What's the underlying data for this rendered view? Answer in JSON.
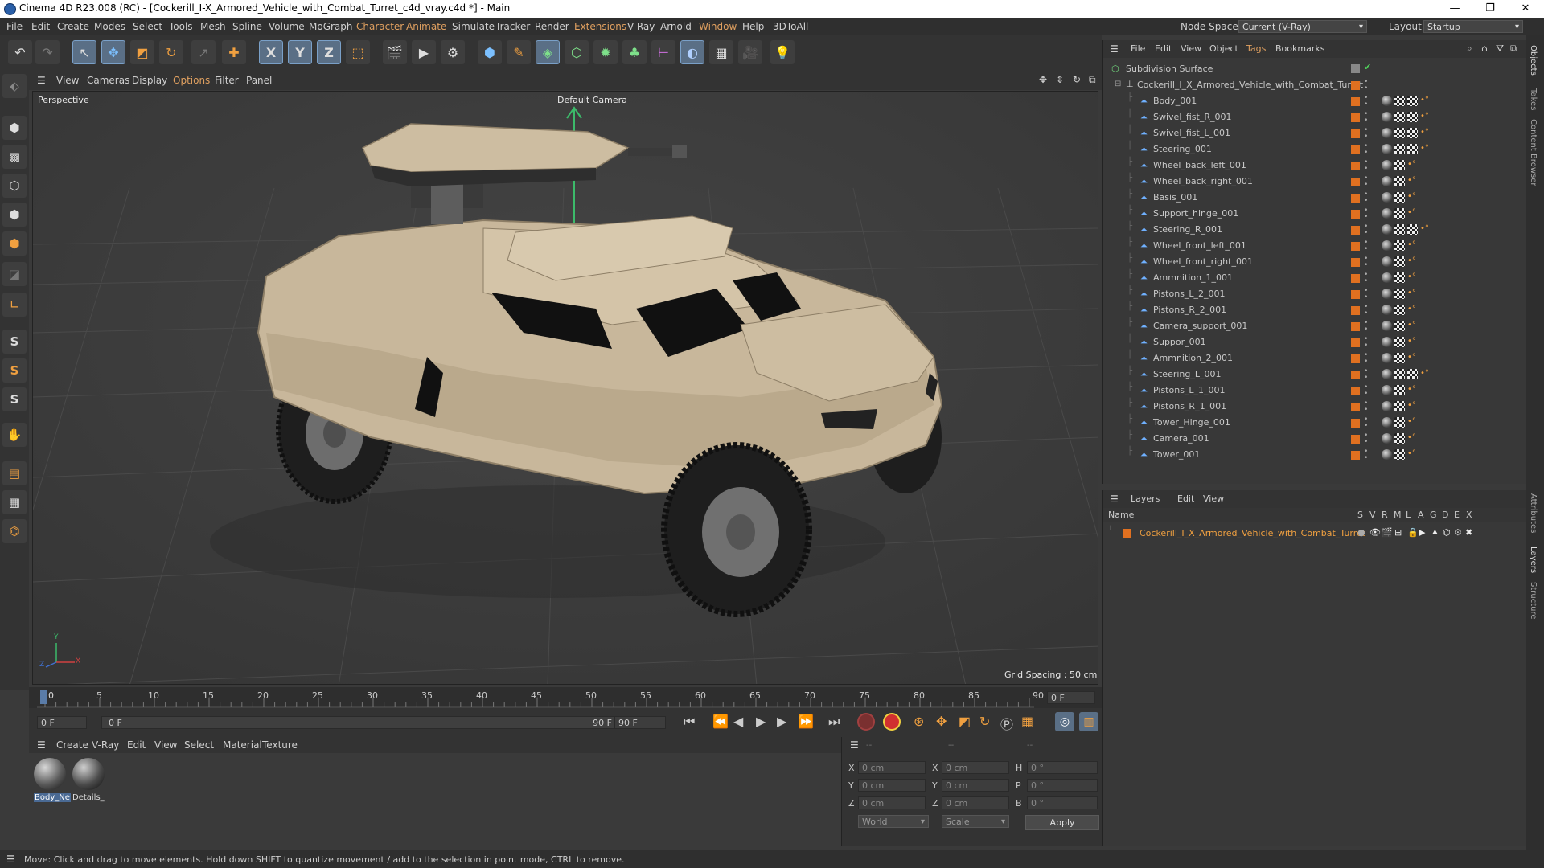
{
  "window": {
    "title": "Cinema 4D R23.008 (RC) - [Cockerill_I-X_Armored_Vehicle_with_Combat_Turret_c4d_vray.c4d *] - Main",
    "minimize": "—",
    "maximize": "❐",
    "close": "✕"
  },
  "menubar": {
    "items": [
      "File",
      "Edit",
      "Create",
      "Modes",
      "Select",
      "Tools",
      "Mesh",
      "Spline",
      "Volume",
      "MoGraph",
      "Character",
      "Animate",
      "Simulate",
      "Tracker",
      "Render",
      "Extensions",
      "V-Ray",
      "Arnold",
      "Window",
      "Help",
      "3DToAll"
    ],
    "node_space_label": "Node Space:",
    "node_space_value": "Current (V-Ray)",
    "layout_label": "Layout:",
    "layout_value": "Startup"
  },
  "viewport": {
    "menu": [
      "View",
      "Cameras",
      "Display",
      "Options",
      "Filter",
      "Panel"
    ],
    "name": "Perspective",
    "camera": "Default Camera",
    "grid_spacing": "Grid Spacing : 50 cm",
    "axis_x": "X",
    "axis_y": "Y",
    "axis_z": "Z"
  },
  "timeline": {
    "ticks": [
      "0",
      "5",
      "10",
      "15",
      "20",
      "25",
      "30",
      "35",
      "40",
      "45",
      "50",
      "55",
      "60",
      "65",
      "70",
      "75",
      "80",
      "85",
      "90"
    ],
    "current_frame": "0 F",
    "start_field": "0 F",
    "range_start": "0 F",
    "range_end": "90 F",
    "end_field": "90 F"
  },
  "materials": {
    "menu": [
      "Create",
      "V-Ray",
      "Edit",
      "View",
      "Select",
      "Material",
      "Texture"
    ],
    "items": [
      {
        "label": "Body_Ne"
      },
      {
        "label": "Details_"
      }
    ]
  },
  "coords": {
    "header_dashes": [
      "--",
      "--",
      "--"
    ],
    "rows": [
      {
        "l1": "X",
        "v1": "0 cm",
        "l2": "X",
        "v2": "0 cm",
        "l3": "H",
        "v3": "0 °"
      },
      {
        "l1": "Y",
        "v1": "0 cm",
        "l2": "Y",
        "v2": "0 cm",
        "l3": "P",
        "v3": "0 °"
      },
      {
        "l1": "Z",
        "v1": "0 cm",
        "l2": "Z",
        "v2": "0 cm",
        "l3": "B",
        "v3": "0 °"
      }
    ],
    "world": "World",
    "scale": "Scale",
    "apply": "Apply"
  },
  "status": {
    "text": "Move: Click and drag to move elements. Hold down SHIFT to quantize movement / add to the selection in point mode, CTRL to remove."
  },
  "objects": {
    "menu": [
      "File",
      "Edit",
      "View",
      "Object",
      "Tags",
      "Bookmarks"
    ],
    "root": "Subdivision Surface",
    "group": "Cockerill_I_X_Armored_Vehicle_with_Combat_Turret",
    "items": [
      {
        "name": "Body_001",
        "tags": 4
      },
      {
        "name": "Swivel_fist_R_001",
        "tags": 4
      },
      {
        "name": "Swivel_fist_L_001",
        "tags": 4
      },
      {
        "name": "Steering_001",
        "tags": 4
      },
      {
        "name": "Wheel_back_left_001",
        "tags": 3
      },
      {
        "name": "Wheel_back_right_001",
        "tags": 3
      },
      {
        "name": "Basis_001",
        "tags": 3
      },
      {
        "name": "Support_hinge_001",
        "tags": 3
      },
      {
        "name": "Steering_R_001",
        "tags": 4
      },
      {
        "name": "Wheel_front_left_001",
        "tags": 3
      },
      {
        "name": "Wheel_front_right_001",
        "tags": 3
      },
      {
        "name": "Ammnition_1_001",
        "tags": 3
      },
      {
        "name": "Pistons_L_2_001",
        "tags": 3
      },
      {
        "name": "Pistons_R_2_001",
        "tags": 3
      },
      {
        "name": "Camera_support_001",
        "tags": 3
      },
      {
        "name": "Suppor_001",
        "tags": 3
      },
      {
        "name": "Ammnition_2_001",
        "tags": 3
      },
      {
        "name": "Steering_L_001",
        "tags": 4
      },
      {
        "name": "Pistons_L_1_001",
        "tags": 3
      },
      {
        "name": "Pistons_R_1_001",
        "tags": 3
      },
      {
        "name": "Tower_Hinge_001",
        "tags": 3
      },
      {
        "name": "Camera_001",
        "tags": 3
      },
      {
        "name": "Tower_001",
        "tags": 3
      }
    ]
  },
  "layers": {
    "menu": [
      "Layers",
      "Edit",
      "View"
    ],
    "name_header": "Name",
    "columns": [
      "S",
      "V",
      "R",
      "M",
      "L",
      "A",
      "G",
      "D",
      "E",
      "X"
    ],
    "items": [
      {
        "name": "Cockerill_I_X_Armored_Vehicle_with_Combat_Turret",
        "color": "#e07020"
      }
    ]
  },
  "side_tabs": [
    "Objects",
    "Takes",
    "Content Browser",
    "Attributes",
    "Layers",
    "Structure"
  ]
}
